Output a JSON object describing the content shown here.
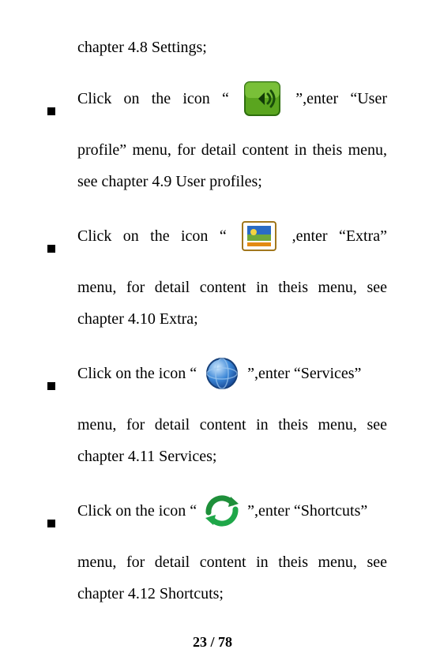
{
  "lead_text": "chapter 4.8 Settings;",
  "items": [
    {
      "pre": "Click on the icon “",
      "post1": "”,enter “User",
      "rest": "profile” menu, for detail content in theis menu, see chapter 4.9 User profiles;",
      "icon": "sound-icon",
      "justify_first": true
    },
    {
      "pre": "Click on the icon “",
      "post1": " ,enter “Extra”",
      "rest": "menu, for detail content in theis menu, see chapter 4.10 Extra;",
      "icon": "extra-icon",
      "justify_first": true
    },
    {
      "pre": "Click on the icon “",
      "post1": "”,enter “Services”",
      "rest": "menu, for detail content in theis menu, see chapter 4.11 Services;",
      "icon": "globe-icon",
      "justify_first": false
    },
    {
      "pre": "Click on the icon “",
      "post1": "”,enter “Shortcuts”",
      "rest": "menu, for detail content in theis menu, see chapter 4.12 Shortcuts;",
      "icon": "refresh-icon",
      "justify_first": false
    }
  ],
  "footer": "23 / 78"
}
